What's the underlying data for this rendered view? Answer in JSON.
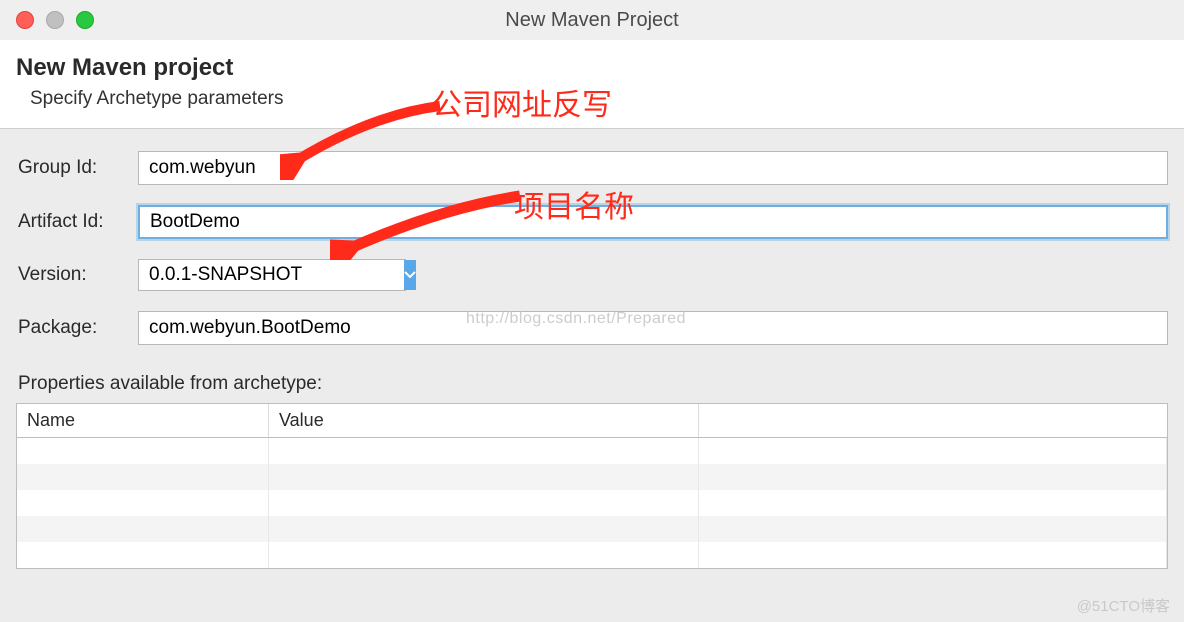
{
  "window": {
    "title": "New Maven Project"
  },
  "header": {
    "title": "New Maven project",
    "subtitle": "Specify Archetype parameters"
  },
  "form": {
    "group_id_label": "Group Id:",
    "group_id_value": "com.webyun",
    "artifact_id_label": "Artifact Id:",
    "artifact_id_value": "BootDemo",
    "version_label": "Version:",
    "version_value": "0.0.1-SNAPSHOT",
    "package_label": "Package:",
    "package_value": "com.webyun.BootDemo"
  },
  "properties": {
    "section_label": "Properties available from archetype:",
    "columns": {
      "name": "Name",
      "value": "Value"
    },
    "rows": []
  },
  "annotations": {
    "a1": "公司网址反写",
    "a2": "项目名称"
  },
  "watermarks": {
    "w1": "http://blog.csdn.net/Prepared",
    "w2": "@51CTO博客"
  }
}
